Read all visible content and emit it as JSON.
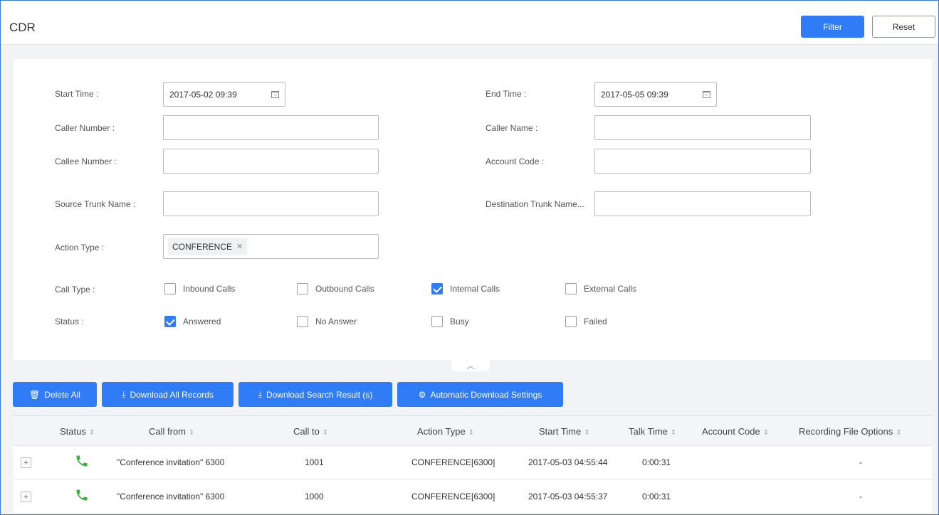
{
  "header": {
    "title": "CDR",
    "filter_label": "Filter",
    "reset_label": "Reset"
  },
  "filters": {
    "start_time_label": "Start Time :",
    "start_time_value": "2017-05-02 09:39",
    "end_time_label": "End Time :",
    "end_time_value": "2017-05-05 09:39",
    "caller_number_label": "Caller Number :",
    "caller_number_value": "",
    "caller_name_label": "Caller Name :",
    "caller_name_value": "",
    "callee_number_label": "Callee Number :",
    "callee_number_value": "",
    "account_code_label": "Account Code :",
    "account_code_value": "",
    "source_trunk_label": "Source Trunk Name :",
    "source_trunk_value": "",
    "destination_trunk_label": "Destination Trunk Name...",
    "destination_trunk_value": "",
    "action_type_label": "Action Type :",
    "action_type_tag": "CONFERENCE",
    "call_type_label": "Call Type :",
    "call_types": [
      {
        "label": "Inbound Calls",
        "checked": false
      },
      {
        "label": "Outbound Calls",
        "checked": false
      },
      {
        "label": "Internal Calls",
        "checked": true
      },
      {
        "label": "External Calls",
        "checked": false
      }
    ],
    "status_label": "Status :",
    "statuses": [
      {
        "label": "Answered",
        "checked": true
      },
      {
        "label": "No Answer",
        "checked": false
      },
      {
        "label": "Busy",
        "checked": false
      },
      {
        "label": "Failed",
        "checked": false
      }
    ]
  },
  "actions": {
    "delete_all": "Delete All",
    "download_all": "Download All Records",
    "download_search": "Download Search Result (s)",
    "auto_download": "Automatic Download Settings"
  },
  "table": {
    "columns": [
      "Status",
      "Call from",
      "Call to",
      "Action Type",
      "Start Time",
      "Talk Time",
      "Account Code",
      "Recording File Options"
    ],
    "rows": [
      {
        "call_from": "\"Conference invitation\" 6300",
        "call_to": "1001",
        "action_type": "CONFERENCE[6300]",
        "start_time": "2017-05-03 04:55:44",
        "talk_time": "0:00:31",
        "account_code": "",
        "recording": "-"
      },
      {
        "call_from": "\"Conference invitation\" 6300",
        "call_to": "1000",
        "action_type": "CONFERENCE[6300]",
        "start_time": "2017-05-03 04:55:37",
        "talk_time": "0:00:31",
        "account_code": "",
        "recording": "-"
      }
    ]
  },
  "colors": {
    "accent": "#2f7cf6",
    "answered_icon": "#3db03d"
  }
}
